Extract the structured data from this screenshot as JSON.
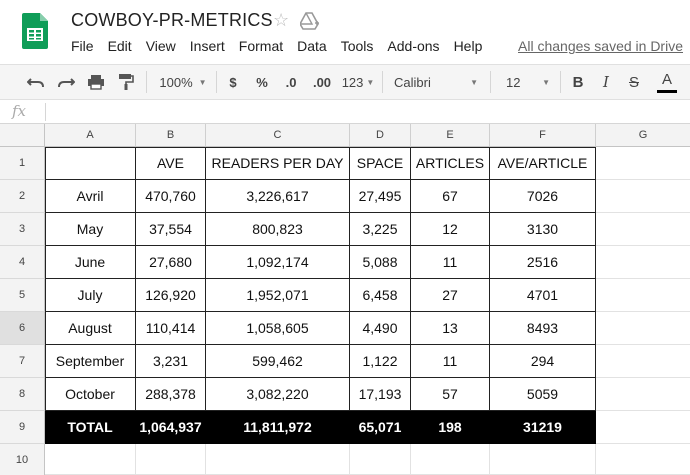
{
  "app": {
    "title": "COWBOY-PR-METRICS",
    "save_status": "All changes saved in Drive",
    "star_icon": "star-icon",
    "drive_icon": "move-to-folder-icon"
  },
  "menu": [
    "File",
    "Edit",
    "View",
    "Insert",
    "Format",
    "Data",
    "Tools",
    "Add-ons",
    "Help"
  ],
  "toolbar": {
    "zoom": "100%",
    "currency": "$",
    "percent": "%",
    "decrease_decimal": ".0",
    "increase_decimal": ".00",
    "more_formats": "123",
    "font": "Calibri",
    "font_size": "12",
    "bold": "B",
    "italic": "I",
    "strike": "S",
    "text_color": "A"
  },
  "formula_bar": {
    "fx": "fx",
    "value": ""
  },
  "columns": [
    "A",
    "B",
    "C",
    "D",
    "E",
    "F",
    "G"
  ],
  "rows": [
    "1",
    "2",
    "3",
    "4",
    "5",
    "6",
    "7",
    "8",
    "9",
    "10"
  ],
  "selected_row": "6",
  "table": {
    "headers": [
      "",
      "AVE",
      "READERS PER DAY",
      "SPACE",
      "ARTICLES",
      "AVE/ARTICLE"
    ],
    "data": [
      [
        "Avril",
        "470,760",
        "3,226,617",
        "27,495",
        "67",
        "7026"
      ],
      [
        "May",
        "37,554",
        "800,823",
        "3,225",
        "12",
        "3130"
      ],
      [
        "June",
        "27,680",
        "1,092,174",
        "5,088",
        "11",
        "2516"
      ],
      [
        "July",
        "126,920",
        "1,952,071",
        "6,458",
        "27",
        "4701"
      ],
      [
        "August",
        "110,414",
        "1,058,605",
        "4,490",
        "13",
        "8493"
      ],
      [
        "September",
        "3,231",
        "599,462",
        "1,122",
        "11",
        "294"
      ],
      [
        "October",
        "288,378",
        "3,082,220",
        "17,193",
        "57",
        "5059"
      ]
    ],
    "total": [
      "TOTAL",
      "1,064,937",
      "11,811,972",
      "65,071",
      "198",
      "31219"
    ]
  },
  "colors": {
    "logo_green": "#0f9d58",
    "total_bg": "#000000",
    "total_fg": "#ffffff"
  }
}
